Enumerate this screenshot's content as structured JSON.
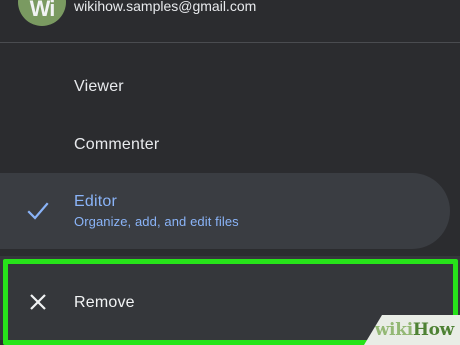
{
  "account": {
    "avatar_initials": "Wi",
    "email": "wikihow.samples@gmail.com"
  },
  "permissions": {
    "viewer_label": "Viewer",
    "commenter_label": "Commenter",
    "editor_label": "Editor",
    "editor_description": "Organize, add, and edit files",
    "selected": "Editor",
    "selected_icon": "check-icon",
    "remove_label": "Remove",
    "remove_icon": "close-icon"
  },
  "colors": {
    "background": "#2b2c2f",
    "selected_row": "#3a3d42",
    "accent_blue": "#8ab4f8",
    "highlight_green": "#27e31a"
  },
  "watermark": {
    "brand_part1": "wiki",
    "brand_part2": "How"
  }
}
